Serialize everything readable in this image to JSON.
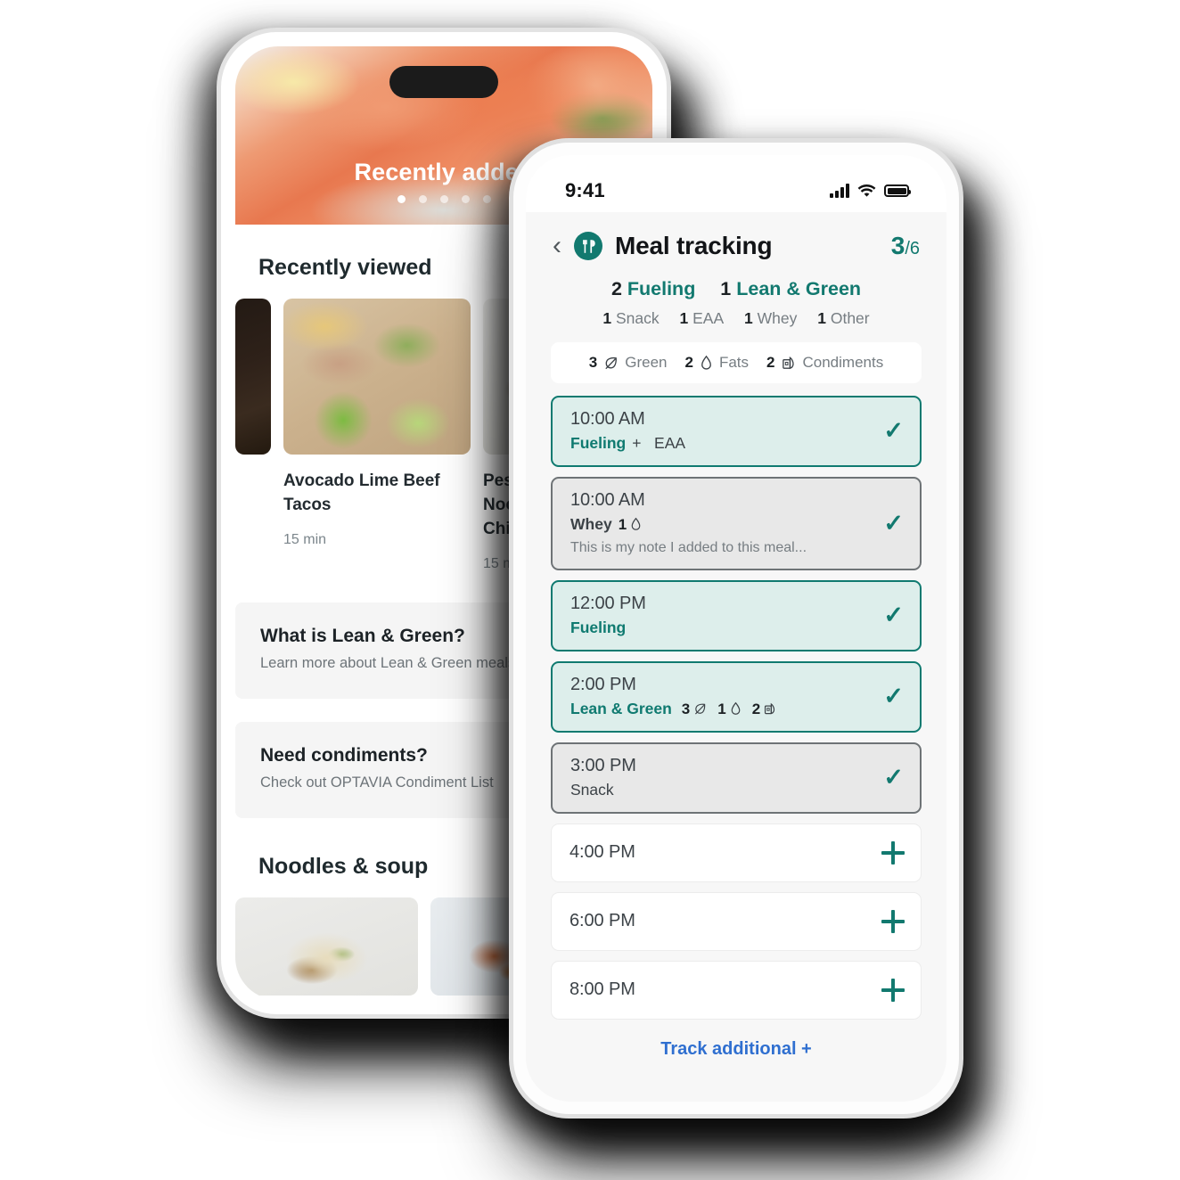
{
  "back_phone": {
    "hero": {
      "title": "Recently added",
      "dots_total": 5,
      "active_dot": 1
    },
    "sections": [
      {
        "title": "Recently viewed"
      },
      {
        "title": "Noodles & soup"
      }
    ],
    "recipes": [
      {
        "name": "Avocado Lime Beef Tacos",
        "time": "15 min"
      },
      {
        "name": "Pesto Zucchini Noodles with Chicken",
        "time": "15 min"
      }
    ],
    "promos": [
      {
        "heading": "What is Lean & Green?",
        "sub": "Learn more about Lean & Green meals"
      },
      {
        "heading": "Need condiments?",
        "sub": "Check out OPTAVIA Condiment List"
      }
    ]
  },
  "front_phone": {
    "status": {
      "time": "9:41",
      "signal_icon": "cellular-bars-icon",
      "wifi_icon": "wifi-icon",
      "battery_icon": "battery-icon"
    },
    "header": {
      "back_icon": "chevron-left-icon",
      "logo_icon": "optavia-fork-knife-logo",
      "title": "Meal tracking",
      "progress_current": "3",
      "progress_total": "/6"
    },
    "summary_primary": [
      {
        "count": "2",
        "label": "Fueling"
      },
      {
        "count": "1",
        "label": "Lean & Green"
      }
    ],
    "summary_secondary": [
      {
        "count": "1",
        "label": "Snack"
      },
      {
        "count": "1",
        "label": "EAA"
      },
      {
        "count": "1",
        "label": "Whey"
      },
      {
        "count": "1",
        "label": "Other"
      }
    ],
    "chips": [
      {
        "count": "3",
        "icon": "leaf-icon",
        "label": "Green"
      },
      {
        "count": "2",
        "icon": "droplet-icon",
        "label": "Fats"
      },
      {
        "count": "2",
        "icon": "condiment-bottle-icon",
        "label": "Condiments"
      }
    ],
    "meals": [
      {
        "time": "10:00 AM",
        "label": "Fueling",
        "extra": "+   EAA",
        "note": "",
        "state": "active",
        "action_icon": "check-icon",
        "counters": []
      },
      {
        "time": "10:00 AM",
        "label": "Whey",
        "extra": "",
        "note": "This is my note I added to this meal...",
        "state": "done",
        "action_icon": "check-icon",
        "counters": [
          {
            "count": "1",
            "icon": "droplet-icon"
          }
        ]
      },
      {
        "time": "12:00 PM",
        "label": "Fueling",
        "extra": "",
        "note": "",
        "state": "active",
        "action_icon": "check-icon",
        "counters": []
      },
      {
        "time": "2:00 PM",
        "label": "Lean & Green",
        "extra": "",
        "note": "",
        "state": "active",
        "action_icon": "check-icon",
        "counters": [
          {
            "count": "3",
            "icon": "leaf-icon"
          },
          {
            "count": "1",
            "icon": "droplet-icon"
          },
          {
            "count": "2",
            "icon": "condiment-bottle-icon"
          }
        ]
      },
      {
        "time": "3:00 PM",
        "label": "Snack",
        "extra": "",
        "note": "",
        "state": "done",
        "action_icon": "check-icon",
        "counters": []
      },
      {
        "time": "4:00 PM",
        "label": "",
        "extra": "",
        "note": "",
        "state": "empty",
        "action_icon": "plus-icon",
        "counters": []
      },
      {
        "time": "6:00 PM",
        "label": "",
        "extra": "",
        "note": "",
        "state": "empty",
        "action_icon": "plus-icon",
        "counters": []
      },
      {
        "time": "8:00 PM",
        "label": "",
        "extra": "",
        "note": "",
        "state": "empty",
        "action_icon": "plus-icon",
        "counters": []
      }
    ],
    "track_additional": "Track additional +"
  },
  "colors": {
    "brand_teal": "#12796f",
    "active_card_bg": "#ddeeeb",
    "active_card_border": "#0f7a70",
    "done_card_bg": "#e8e8e8",
    "done_card_border": "#6e7376",
    "link_blue": "#2f6fd0",
    "screen_bg": "#f7f7f7"
  }
}
